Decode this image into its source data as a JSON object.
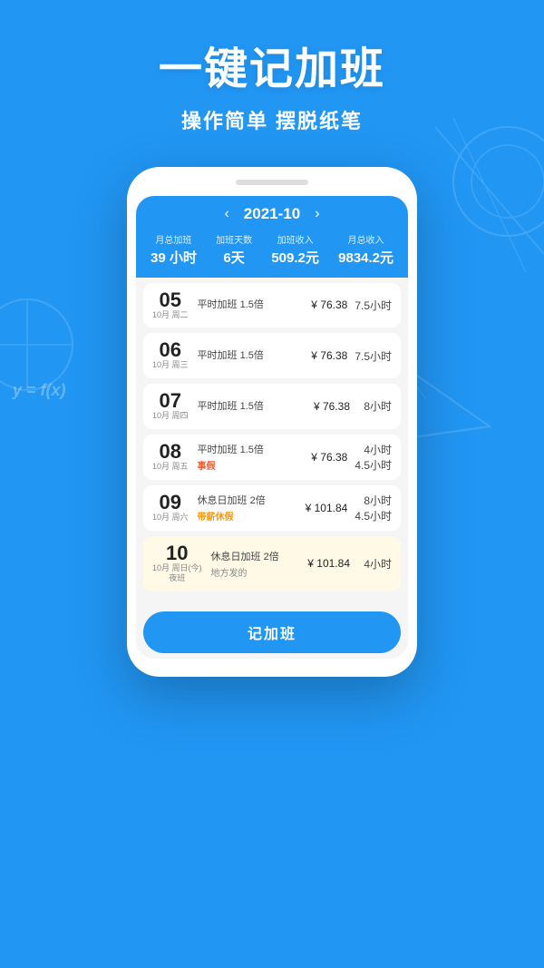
{
  "header": {
    "main_title": "一键记加班",
    "sub_title": "操作简单 摆脱纸笔"
  },
  "phone": {
    "month_nav": {
      "prev": "‹",
      "label": "2021-10",
      "next": "›"
    },
    "stats": [
      {
        "label": "月总加班",
        "value": "39 小时"
      },
      {
        "label": "加班天数",
        "value": "6天"
      },
      {
        "label": "加班收入",
        "value": "509.2元"
      },
      {
        "label": "月总收入",
        "value": "9834.2元"
      }
    ],
    "records": [
      {
        "date_num": "05",
        "date_sub": "10月 周二",
        "type": "平时加班 1.5倍",
        "tag": null,
        "amount": "¥ 76.38",
        "hours": "7.5小时",
        "hours2": null,
        "note": null,
        "highlighted": false
      },
      {
        "date_num": "06",
        "date_sub": "10月 周三",
        "type": "平时加班 1.5倍",
        "tag": null,
        "amount": "¥ 76.38",
        "hours": "7.5小时",
        "hours2": null,
        "note": null,
        "highlighted": false
      },
      {
        "date_num": "07",
        "date_sub": "10月 周四",
        "type": "平时加班 1.5倍",
        "tag": null,
        "amount": "¥ 76.38",
        "hours": "8小时",
        "hours2": null,
        "note": null,
        "highlighted": false
      },
      {
        "date_num": "08",
        "date_sub": "10月 周五",
        "type": "平时加班 1.5倍",
        "tag": "事假",
        "tag_class": "tag-event",
        "amount": "¥ 76.38",
        "hours": "4小时",
        "hours2": "4.5小时",
        "note": null,
        "highlighted": false
      },
      {
        "date_num": "09",
        "date_sub": "10月 周六",
        "type": "休息日加班 2倍",
        "tag": "带薪休假",
        "tag_class": "tag-paid",
        "amount": "¥ 101.84",
        "hours": "8小时",
        "hours2": "4.5小时",
        "note": null,
        "highlighted": false
      },
      {
        "date_num": "10",
        "date_sub": "10月 周日(今)\n夜班",
        "type": "休息日加班 2倍",
        "tag": null,
        "amount": "¥ 101.84",
        "hours": "4小时",
        "hours2": null,
        "note": "地方发的",
        "highlighted": true
      }
    ],
    "btn_label": "记加班"
  },
  "formula": "y = f(x)"
}
